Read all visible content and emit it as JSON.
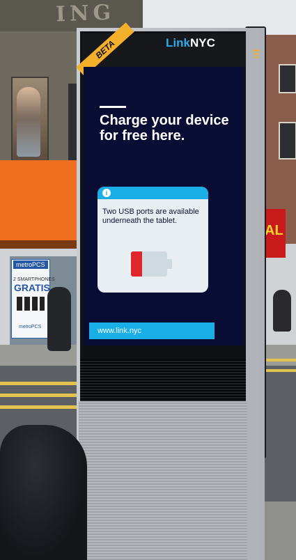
{
  "scene": {
    "building_sign": "ING",
    "shelter_ad": {
      "brand": "metroPCS",
      "promo_line": "2 SMARTPHONES",
      "headline": "GRATIS",
      "brand_bottom": "metroPCS"
    },
    "store_sign": "AL"
  },
  "kiosk": {
    "ribbon": "BETA",
    "brand_prefix": "Link",
    "brand_suffix": "NYC",
    "screen": {
      "headline": "Charge your device for free here.",
      "info_icon": "i",
      "info_text": "Two USB ports are available underneath the tablet.",
      "battery_level": 0.3,
      "url": "www.link.nyc"
    }
  },
  "colors": {
    "brand_blue": "#19aee6",
    "ribbon_yellow": "#f4b02a",
    "screen_navy": "#0a0d33",
    "battery_red": "#e0262c"
  },
  "icons": [
    "wifi-icon",
    "info-icon",
    "battery-icon"
  ]
}
